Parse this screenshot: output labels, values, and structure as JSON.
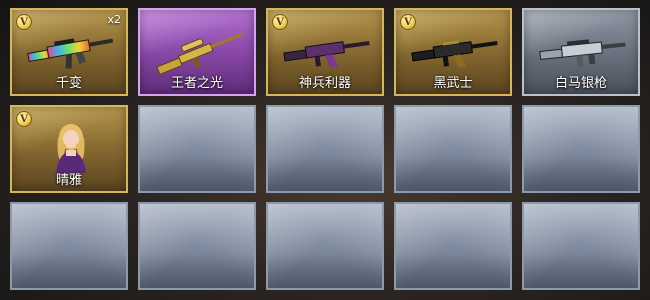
{
  "inventory": {
    "items": [
      {
        "name": "千变",
        "count": "x2",
        "rarity": "gold",
        "badge": "V",
        "icon": "rainbow-rifle-icon"
      },
      {
        "name": "王者之光",
        "rarity": "purple",
        "icon": "gold-sniper-rifle-icon"
      },
      {
        "name": "神兵利器",
        "rarity": "gold",
        "badge": "V",
        "icon": "purple-assault-rifle-icon"
      },
      {
        "name": "黑武士",
        "rarity": "gold",
        "badge": "V",
        "icon": "black-assault-rifle-icon"
      },
      {
        "name": "白马银枪",
        "rarity": "silver",
        "icon": "silver-rifle-icon"
      },
      {
        "name": "晴雅",
        "rarity": "gold",
        "badge": "V",
        "icon": "character-portrait-icon"
      }
    ],
    "empty_slots": 9
  }
}
